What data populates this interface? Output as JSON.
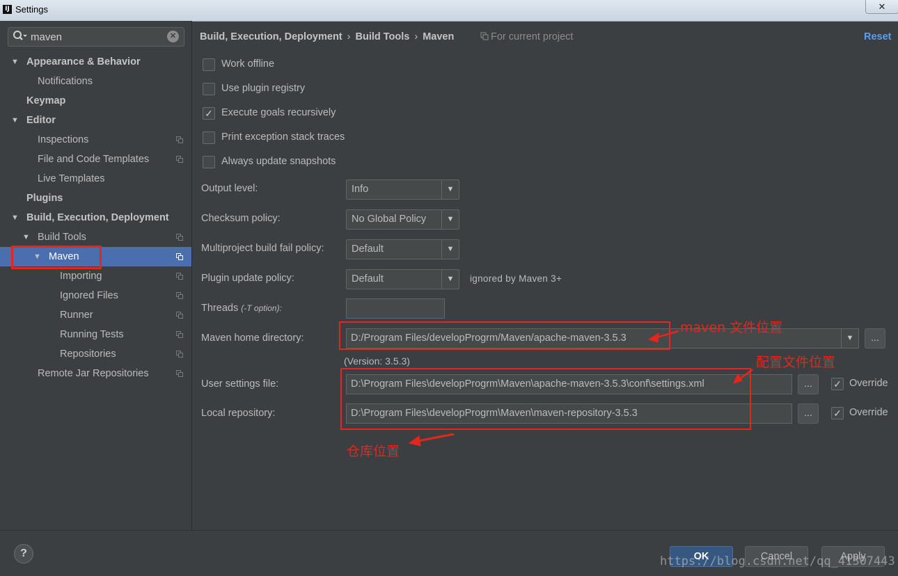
{
  "window": {
    "title": "Settings",
    "app_icon": "IJ",
    "close_label": "✕"
  },
  "search": {
    "value": "maven",
    "icon": "search-icon",
    "clear": "✕"
  },
  "tree": [
    {
      "id": "appearance",
      "label": "Appearance & Behavior",
      "bold": true,
      "arrow": "▼"
    },
    {
      "id": "notifications",
      "label": "Notifications"
    },
    {
      "id": "keymap",
      "label": "Keymap",
      "bold": true
    },
    {
      "id": "editor",
      "label": "Editor",
      "bold": true,
      "arrow": "▼"
    },
    {
      "id": "inspections",
      "label": "Inspections",
      "project": true
    },
    {
      "id": "file-code-templates",
      "label": "File and Code Templates",
      "project": true
    },
    {
      "id": "live-templates",
      "label": "Live Templates"
    },
    {
      "id": "plugins",
      "label": "Plugins",
      "bold": true
    },
    {
      "id": "build-exec-deploy",
      "label": "Build, Execution, Deployment",
      "bold": true,
      "arrow": "▼"
    },
    {
      "id": "build-tools",
      "label": "Build Tools",
      "arrow": "▼",
      "project": true
    },
    {
      "id": "maven",
      "label": "Maven",
      "arrow": "▼",
      "project": true,
      "selected": true
    },
    {
      "id": "importing",
      "label": "Importing",
      "project": true
    },
    {
      "id": "ignored-files",
      "label": "Ignored Files",
      "project": true
    },
    {
      "id": "runner",
      "label": "Runner",
      "project": true
    },
    {
      "id": "running-tests",
      "label": "Running Tests",
      "project": true
    },
    {
      "id": "repositories",
      "label": "Repositories",
      "project": true
    },
    {
      "id": "remote-jar-repos",
      "label": "Remote Jar Repositories",
      "project": true
    }
  ],
  "breadcrumb": {
    "items": [
      "Build, Execution, Deployment",
      "Build Tools",
      "Maven"
    ],
    "separator": "›",
    "scope": "For current project"
  },
  "reset_label": "Reset",
  "checkboxes": [
    {
      "label": "Work offline",
      "checked": false
    },
    {
      "label": "Use plugin registry",
      "checked": false
    },
    {
      "label": "Execute goals recursively",
      "checked": true
    },
    {
      "label": "Print exception stack traces",
      "checked": false
    },
    {
      "label": "Always update snapshots",
      "checked": false
    }
  ],
  "form": {
    "output_level": {
      "label": "Output level:",
      "value": "Info"
    },
    "checksum_policy": {
      "label": "Checksum policy:",
      "value": "No Global Policy"
    },
    "multiproject_policy": {
      "label": "Multiproject build fail policy:",
      "value": "Default"
    },
    "plugin_update_policy": {
      "label": "Plugin update policy:",
      "value": "Default",
      "note": "ignored by Maven 3+"
    },
    "threads": {
      "label": "Threads",
      "hint": "(-T option):",
      "value": ""
    },
    "maven_home": {
      "label": "Maven home directory:",
      "value": "D:/Program Files/developProgrm/Maven/apache-maven-3.5.3",
      "version": "(Version: 3.5.3)"
    },
    "user_settings": {
      "label": "User settings file:",
      "value": "D:\\Program Files\\developProgrm\\Maven\\apache-maven-3.5.3\\conf\\settings.xml",
      "override_label": "Override",
      "override": true
    },
    "local_repo": {
      "label": "Local repository:",
      "value": "D:\\Program Files\\developProgrm\\Maven\\maven-repository-3.5.3",
      "override_label": "Override",
      "override": true
    }
  },
  "annotations": {
    "maven_home": "maven 文件位置",
    "settings": "配置文件位置",
    "repository": "仓库位置"
  },
  "buttons": {
    "ok": "OK",
    "cancel": "Cancel",
    "apply": "Apply",
    "help": "?",
    "browse": "..."
  },
  "watermark": "https://blog.csdn.net/qq_41307443",
  "colors": {
    "background": "#3c3f41",
    "selection": "#4b6eaf",
    "accent_link": "#589df6",
    "annotation_red": "#e8251c",
    "ok_button": "#365880"
  }
}
